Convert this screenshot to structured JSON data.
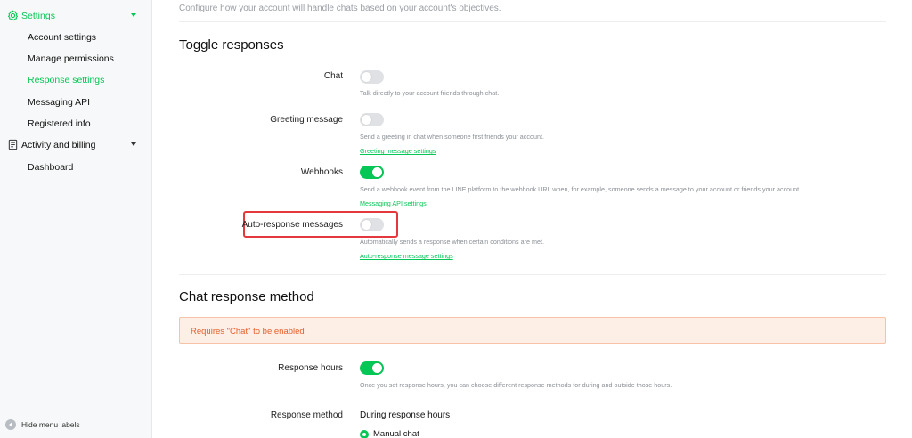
{
  "sidebar": {
    "settings": {
      "label": "Settings",
      "icon": "gear-icon"
    },
    "items": [
      {
        "label": "Account settings",
        "active": false
      },
      {
        "label": "Manage permissions",
        "active": false
      },
      {
        "label": "Response settings",
        "active": true
      },
      {
        "label": "Messaging API",
        "active": false
      },
      {
        "label": "Registered info",
        "active": false
      }
    ],
    "billing": {
      "label": "Activity and billing",
      "icon": "document-icon"
    },
    "billing_items": [
      {
        "label": "Dashboard"
      }
    ],
    "hide_labels": "Hide menu labels"
  },
  "main": {
    "intro": "Configure how your account will handle chats based on your account's objectives.",
    "toggle_section": {
      "title": "Toggle responses",
      "rows": [
        {
          "label": "Chat",
          "on": false,
          "desc": "Talk directly to your account friends through chat."
        },
        {
          "label": "Greeting message",
          "on": false,
          "desc": "Send a greeting in chat when someone first friends your account.",
          "link": "Greeting message settings"
        },
        {
          "label": "Webhooks",
          "on": true,
          "desc": "Send a webhook event from the LINE platform to the webhook URL when, for example, someone sends a message to your account or friends your account.",
          "link": "Messaging API settings"
        },
        {
          "label": "Auto-response messages",
          "on": false,
          "desc": "Automatically sends a response when certain conditions are met.",
          "link": "Auto-response message settings"
        }
      ]
    },
    "method_section": {
      "title": "Chat response method",
      "warning": "Requires \"Chat\" to be enabled",
      "response_hours": {
        "label": "Response hours",
        "on": true,
        "desc": "Once you set response hours, you can choose different response methods for during and outside those hours."
      },
      "response_method": {
        "label": "Response method",
        "sub_label": "During response hours",
        "option": "Manual chat"
      }
    }
  },
  "colors": {
    "accent": "#06c755",
    "highlight": "#e4383c",
    "warning_text": "#e6602a",
    "warning_bg": "#fdeee6"
  }
}
